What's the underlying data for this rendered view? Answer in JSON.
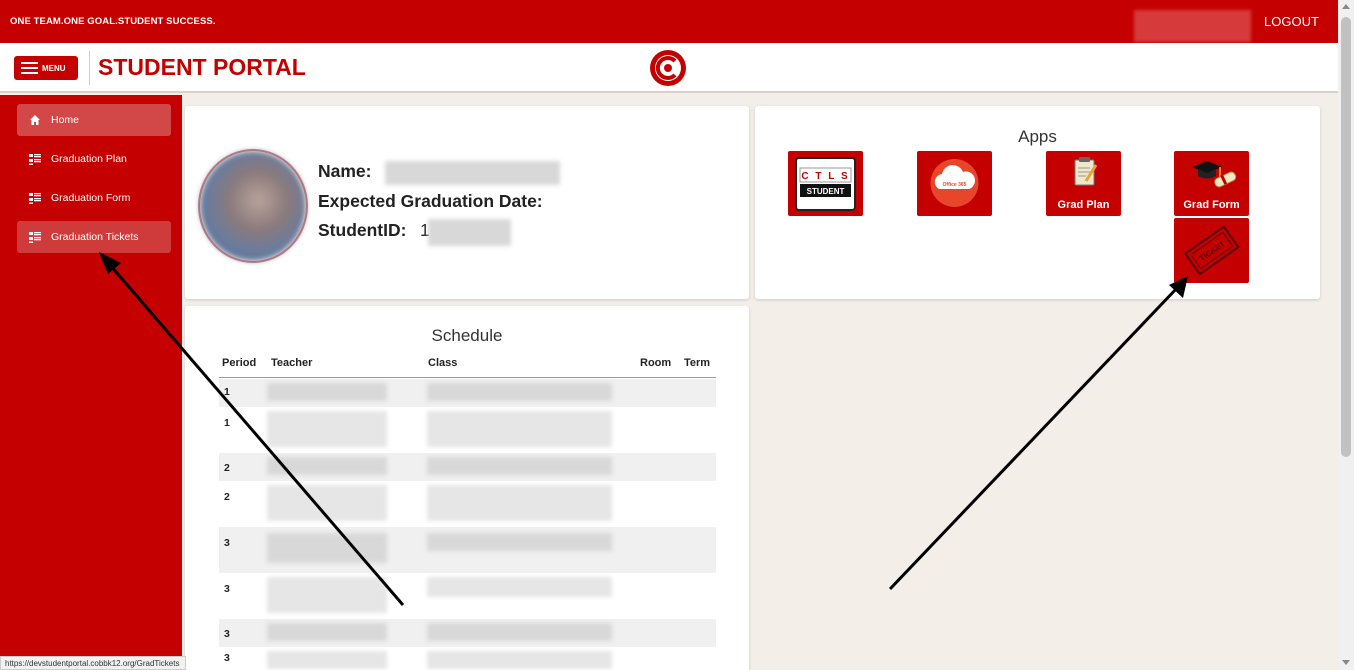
{
  "topbar": {
    "motto": "ONE TEAM.ONE GOAL.STUDENT SUCCESS.",
    "logout_label": "LOGOUT"
  },
  "header": {
    "menu_label": "MENU",
    "title": "STUDENT PORTAL"
  },
  "sidebar": {
    "items": [
      {
        "label": "Home",
        "icon": "home-icon"
      },
      {
        "label": "Graduation Plan",
        "icon": "list-icon"
      },
      {
        "label": "Graduation Form",
        "icon": "list-icon"
      },
      {
        "label": "Graduation Tickets",
        "icon": "list-icon"
      }
    ]
  },
  "profile": {
    "name_label": "Name:",
    "grad_date_label": "Expected Graduation Date:",
    "student_id_label": "StudentID:",
    "student_id_prefix": "1"
  },
  "apps": {
    "title": "Apps",
    "tiles": [
      {
        "caption": "",
        "icon": "ctls-student-icon",
        "logo_text": "C T L S",
        "logo_sub": "STUDENT"
      },
      {
        "caption": "",
        "icon": "office365-icon",
        "logo_text": "Office 365"
      },
      {
        "caption": "Grad Plan",
        "icon": "clipboard-pencil-icon"
      },
      {
        "caption": "Grad Form",
        "icon": "graduation-cap-diploma-icon"
      },
      {
        "caption": "",
        "icon": "ticket-icon",
        "logo_text": "TICKET"
      }
    ]
  },
  "schedule": {
    "title": "Schedule",
    "columns": [
      "Period",
      "Teacher",
      "Class",
      "Room",
      "Term"
    ],
    "periods": [
      "1",
      "1",
      "2",
      "2",
      "3",
      "3",
      "3",
      "3"
    ]
  },
  "statusbar": {
    "url": "https://devstudentportal.cobbk12.org/GradTickets"
  },
  "colors": {
    "brand_red": "#c40000",
    "page_bg": "#f3eee8"
  }
}
